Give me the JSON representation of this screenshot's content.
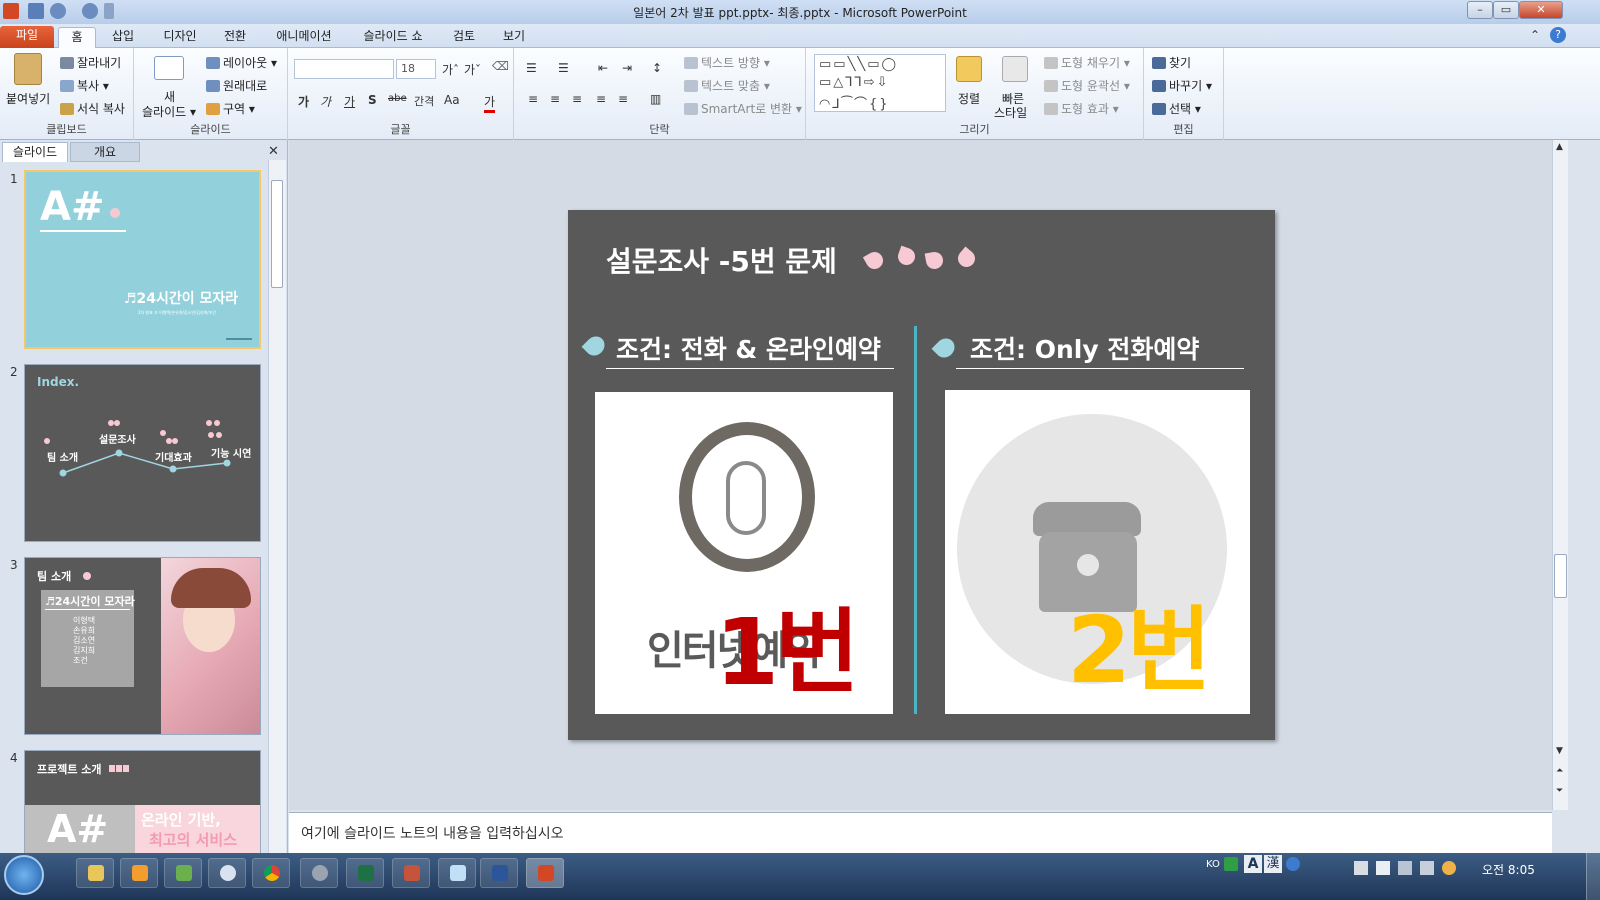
{
  "window": {
    "title": "일본어 2차 발표 ppt.pptx- 최종.pptx  -  Microsoft PowerPoint"
  },
  "ribbon_tabs": [
    "파일",
    "홈",
    "삽입",
    "디자인",
    "전환",
    "애니메이션",
    "슬라이드 쇼",
    "검토",
    "보기"
  ],
  "ribbon": {
    "clipboard": {
      "paste": "붙여넣기",
      "cut": "잘라내기",
      "copy": "복사",
      "format_painter": "서식 복사",
      "label": "클립보드"
    },
    "slides": {
      "new_slide_top": "새",
      "new_slide_bottom": "슬라이드",
      "layout": "레이아웃",
      "reset": "원래대로",
      "section": "구역",
      "label": "슬라이드"
    },
    "font": {
      "size": "18",
      "label": "글꼴",
      "bold": "가",
      "italic": "가",
      "underline": "가",
      "shadow": "S",
      "strike": "abe",
      "spacing": "간격",
      "case": "Aa",
      "color": "가"
    },
    "paragraph": {
      "text_direction": "텍스트 방향",
      "align_text": "텍스트 맞춤",
      "smartart": "SmartArt로 변환",
      "label": "단락"
    },
    "drawing": {
      "arrange": "정렬",
      "quick_styles_top": "빠른",
      "quick_styles_bottom": "스타일",
      "fill": "도형 채우기",
      "outline": "도형 윤곽선",
      "effects": "도형 효과",
      "label": "그리기"
    },
    "editing": {
      "find": "찾기",
      "replace": "바꾸기",
      "select": "선택",
      "label": "편집"
    }
  },
  "left_pane": {
    "tabs": [
      "슬라이드",
      "개요"
    ],
    "thumbnails": [
      {
        "num": "1",
        "logo": "A#",
        "subtitle": "♬24시간이 모자라",
        "tiny": "2차 발표 조 이형택/손유희/김소연/김지희/조건"
      },
      {
        "num": "2",
        "title": "Index.",
        "items": [
          "팀 소개",
          "설문조사",
          "기대효과",
          "기능 시연"
        ]
      },
      {
        "num": "3",
        "title": "팀 소개",
        "box_title": "♬24시간이 모자라",
        "members": [
          "이형택",
          "손유희",
          "김소연",
          "김지희",
          "조건"
        ]
      },
      {
        "num": "4",
        "title": "프로젝트 소개",
        "logo": "A#",
        "tagline_1": "온라인 기반,",
        "tagline_2": "최고의 서비스"
      }
    ]
  },
  "slide": {
    "title": "설문조사 -5번 문제",
    "left_heading": "조건: 전화 & 온라인예약",
    "right_heading": "조건: Only 전화예약",
    "left_image_text": "인터넷예약",
    "left_number": "1번",
    "right_number": "2번",
    "colors": {
      "background": "#595959",
      "accent": "#4bb3c4",
      "red": "#c00000",
      "yellow": "#ffc000"
    }
  },
  "notes": {
    "placeholder": "여기에 슬라이드 노트의 내용을 입력하십시오"
  },
  "taskbar": {
    "lang": "KO",
    "ime_a": "A",
    "ime_han": "漢",
    "clock": "오전 8:05"
  }
}
